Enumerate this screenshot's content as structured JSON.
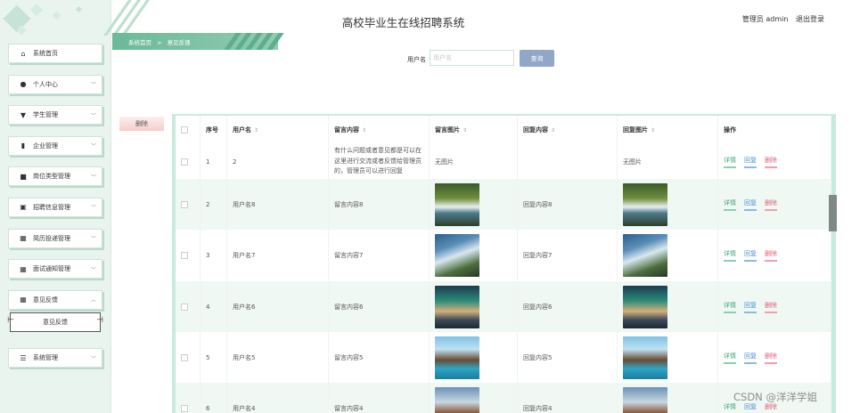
{
  "header": {
    "app_title": "高校毕业生在线招聘系统",
    "user_label": "管理员 admin",
    "logout_label": "退出登录"
  },
  "breadcrumb": {
    "home": "系统首页",
    "separator": ">",
    "current": "意见反馈"
  },
  "sidebar": {
    "items": [
      {
        "label": "系统首页",
        "icon": "home-icon",
        "expandable": false
      },
      {
        "label": "个人中心",
        "icon": "user-icon",
        "expandable": true
      },
      {
        "label": "学生管理",
        "icon": "student-icon",
        "expandable": true
      },
      {
        "label": "企业管理",
        "icon": "chart-icon",
        "expandable": true
      },
      {
        "label": "岗位类型管理",
        "icon": "category-icon",
        "expandable": true
      },
      {
        "label": "招聘信息管理",
        "icon": "document-icon",
        "expandable": true
      },
      {
        "label": "简历投递管理",
        "icon": "grid-icon",
        "expandable": true
      },
      {
        "label": "面试通知管理",
        "icon": "grid-icon",
        "expandable": true
      },
      {
        "label": "意见反馈",
        "icon": "grid-icon",
        "expandable": true,
        "expanded": true
      }
    ],
    "active_sub": "意见反馈",
    "last_item": {
      "label": "系统管理",
      "icon": "settings-icon"
    }
  },
  "search": {
    "label": "用户名",
    "placeholder": "用户名",
    "button_label": "查询"
  },
  "actions": {
    "delete_label": "删除"
  },
  "table": {
    "columns": [
      "序号",
      "用户名",
      "留言内容",
      "留言图片",
      "回复内容",
      "回复图片",
      "操作"
    ],
    "op_labels": {
      "detail": "详情",
      "reply": "回复",
      "delete": "删除"
    },
    "no_image": "无图片",
    "rows": [
      {
        "index": "1",
        "username": "2",
        "message": "有什么问题或者意见都是可以在这里进行交流或者反馈给管理员的，管理员可以进行回复",
        "message_image": "",
        "reply": "",
        "reply_image": ""
      },
      {
        "index": "2",
        "username": "用户名8",
        "message": "留言内容8",
        "message_image": "waterfall-forest",
        "reply": "回复内容8",
        "reply_image": "waterfall-forest"
      },
      {
        "index": "3",
        "username": "用户名7",
        "message": "留言内容7",
        "message_image": "waterfall-cliff",
        "reply": "回复内容7",
        "reply_image": "waterfall-cliff"
      },
      {
        "index": "4",
        "username": "用户名6",
        "message": "留言内容6",
        "message_image": "aurora-cabin",
        "reply": "回复内容6",
        "reply_image": "aurora-cabin"
      },
      {
        "index": "5",
        "username": "用户名5",
        "message": "留言内容5",
        "message_image": "tropical-pier",
        "reply": "回复内容5",
        "reply_image": "tropical-pier"
      },
      {
        "index": "6",
        "username": "用户名4",
        "message": "留言内容4",
        "message_image": "mountain-lake",
        "reply": "回复内容4",
        "reply_image": "mountain-lake"
      }
    ]
  },
  "watermark": "CSDN @洋洋学姐",
  "colors": {
    "accent": "#6cb997",
    "sidebar_bg": "#e9f4ef",
    "search_button": "#91a7c8",
    "delete_link": "#e0607a",
    "reply_link": "#4a8fd6"
  }
}
